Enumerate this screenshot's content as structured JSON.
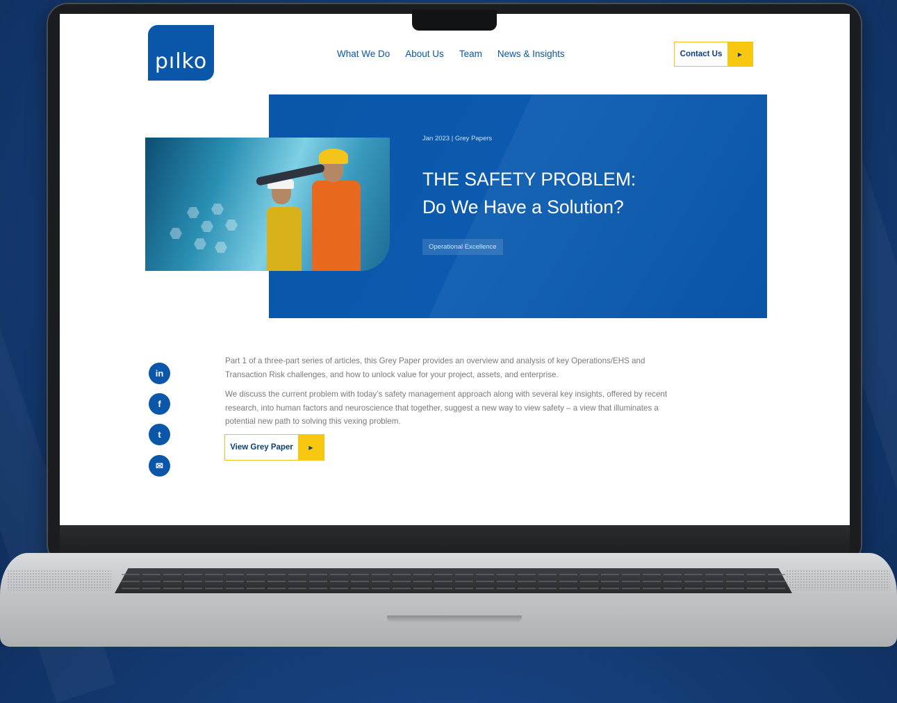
{
  "site": {
    "logo_text": "pılko",
    "nav": [
      "What We Do",
      "About Us",
      "Team",
      "News & Insights"
    ],
    "contact_button": "Contact Us",
    "arrow_glyph": "▶"
  },
  "hero": {
    "meta": "Jan 2023 | Grey Papers",
    "title_line1": "THE SAFETY PROBLEM:",
    "title_line2": "Do We Have a Solution?",
    "tag": "Operational Excellence"
  },
  "social": [
    "in",
    "f",
    "t",
    "✉"
  ],
  "body": {
    "para1": "Part 1 of a three-part series of articles, this Grey Paper provides an overview and analysis of key Operations/EHS and Transaction Risk challenges, and how to unlock value for your project, assets, and enterprise.",
    "para2": "We discuss the current problem with today’s safety management approach along with several key insights, offered by recent research, into human factors and neuroscience that together, suggest a new way to view safety – a view that illuminates a potential new path to solving this vexing problem.",
    "cta": "View Grey Paper"
  },
  "colors": {
    "brand_blue": "#0a56a8",
    "accent_yellow": "#f7c80f"
  }
}
